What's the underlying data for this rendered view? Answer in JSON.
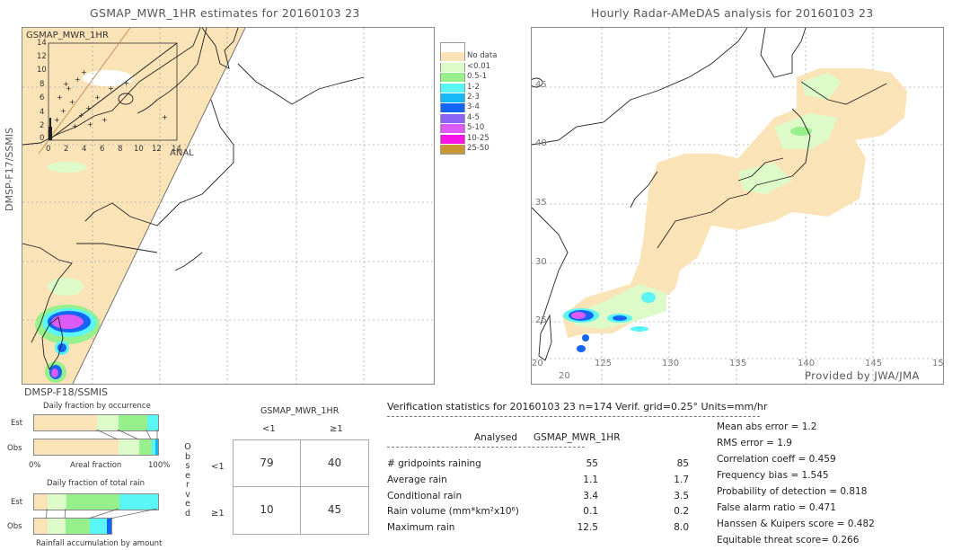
{
  "left_panel": {
    "title": "GSMAP_MWR_1HR estimates for 20160103 23",
    "y_axis_label": "DMSP-F17/SSMIS",
    "bottom_label": "DMSP-F18/SSMIS",
    "inset": {
      "title": "GSMAP_MWR_1HR",
      "x_label": "ANAL",
      "y_ticks": [
        "14",
        "12",
        "10",
        "8",
        "6",
        "4",
        "2",
        "0"
      ],
      "x_ticks": [
        "0",
        "2",
        "4",
        "6",
        "8",
        "10",
        "12",
        "14"
      ]
    }
  },
  "legend": {
    "items": [
      {
        "label": "",
        "color": "#ffffff"
      },
      {
        "label": "No data",
        "color": "#fbe3b8"
      },
      {
        "label": "<0.01",
        "color": "#dcfbc8"
      },
      {
        "label": "0.5-1",
        "color": "#96f08c"
      },
      {
        "label": "1-2",
        "color": "#5af5f5"
      },
      {
        "label": "2-3",
        "color": "#14b9f5"
      },
      {
        "label": "3-4",
        "color": "#1464f5"
      },
      {
        "label": "4-5",
        "color": "#8c64f5"
      },
      {
        "label": "5-10",
        "color": "#dc5af5"
      },
      {
        "label": "10-25",
        "color": "#f514e6"
      },
      {
        "label": "25-50",
        "color": "#c89632"
      }
    ]
  },
  "right_panel": {
    "title": "Hourly Radar-AMeDAS analysis for 20160103 23",
    "lat_labels": [
      "45",
      "40",
      "35",
      "30",
      "25"
    ],
    "lon_labels": [
      "125",
      "130",
      "135",
      "140",
      "145"
    ],
    "edge_labels": {
      "left_bottom": "20",
      "right_bottom": "15",
      "bottom": "20"
    },
    "credit": "Provided by JWA/JMA"
  },
  "occurrence_chart": {
    "title": "Daily fraction by occurrence",
    "row_labels": [
      "Est",
      "Obs"
    ],
    "x_left": "0%",
    "x_mid": "Areal fraction",
    "x_right": "100%",
    "est": [
      {
        "color": "#fbe3b8",
        "fraction": 0.51
      },
      {
        "color": "#dcfbc8",
        "fraction": 0.17
      },
      {
        "color": "#96f08c",
        "fraction": 0.23
      },
      {
        "color": "#5af5f5",
        "fraction": 0.09
      }
    ],
    "obs": [
      {
        "color": "#fbe3b8",
        "fraction": 0.68
      },
      {
        "color": "#dcfbc8",
        "fraction": 0.17
      },
      {
        "color": "#96f08c",
        "fraction": 0.1
      },
      {
        "color": "#5af5f5",
        "fraction": 0.03
      },
      {
        "color": "#14b9f5",
        "fraction": 0.02
      }
    ]
  },
  "total_rain_chart": {
    "title": "Daily fraction of total rain",
    "row_labels": [
      "Est",
      "Obs"
    ],
    "bottom_label": "Rainfall accumulation by amount",
    "est": [
      {
        "color": "#fbe3b8",
        "fraction": 0.11
      },
      {
        "color": "#dcfbc8",
        "fraction": 0.15
      },
      {
        "color": "#96f08c",
        "fraction": 0.43
      },
      {
        "color": "#5af5f5",
        "fraction": 0.31
      }
    ],
    "obs_scale": 0.62,
    "obs": [
      {
        "color": "#fbe3b8",
        "fraction": 0.17
      },
      {
        "color": "#dcfbc8",
        "fraction": 0.24
      },
      {
        "color": "#96f08c",
        "fraction": 0.31
      },
      {
        "color": "#5af5f5",
        "fraction": 0.23
      },
      {
        "color": "#1464f5",
        "fraction": 0.05
      }
    ]
  },
  "contingency": {
    "header": "GSMAP_MWR_1HR",
    "col_labels": [
      "<1",
      "≥1"
    ],
    "row_labels": [
      "<1",
      "≥1"
    ],
    "side_label": [
      "O",
      "b",
      "s",
      "e",
      "r",
      "v",
      "e",
      "d"
    ],
    "cells": [
      [
        "79",
        "40"
      ],
      [
        "10",
        "45"
      ]
    ]
  },
  "verification": {
    "header": "Verification statistics for 20160103 23   n=174   Verif. grid=0.25°   Units=mm/hr",
    "col_analysed": "Analysed",
    "col_model": "GSMAP_MWR_1HR",
    "rows": [
      {
        "label": "# gridpoints raining",
        "analysed": "55",
        "model": "85"
      },
      {
        "label": "Average rain",
        "analysed": "1.1",
        "model": "1.7"
      },
      {
        "label": "Conditional rain",
        "analysed": "3.4",
        "model": "3.5"
      },
      {
        "label": "Rain volume (mm*km²x10⁶)",
        "analysed": "0.1",
        "model": "0.2"
      },
      {
        "label": "Maximum rain",
        "analysed": "12.5",
        "model": "8.0"
      }
    ],
    "scores": [
      "Mean abs error = 1.2",
      "RMS error = 1.9",
      "Correlation coeff = 0.459",
      "Frequency bias = 1.545",
      "Probability of detection = 0.818",
      "False alarm ratio = 0.471",
      "Hanssen & Kuipers score = 0.482",
      "Equitable threat score= 0.266"
    ]
  }
}
